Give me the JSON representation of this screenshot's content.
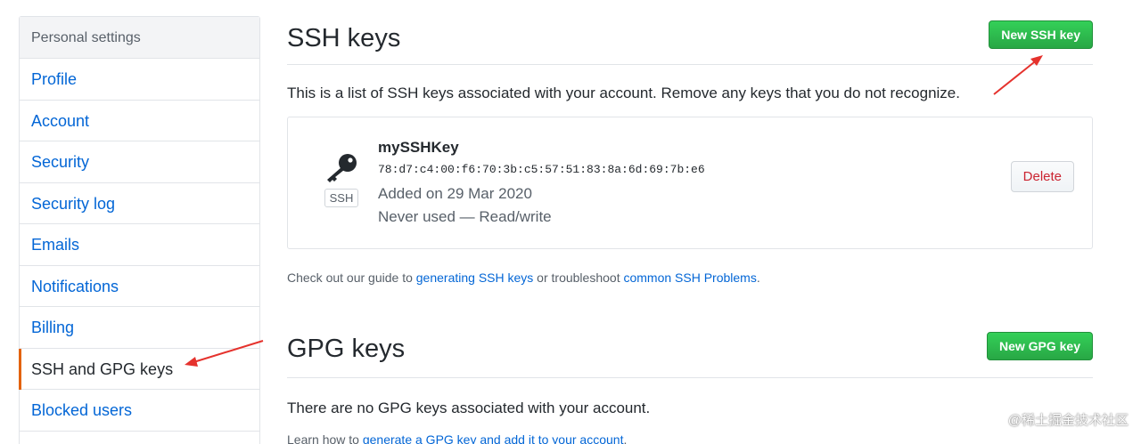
{
  "sidebar": {
    "header": "Personal settings",
    "items": [
      {
        "label": "Profile"
      },
      {
        "label": "Account"
      },
      {
        "label": "Security"
      },
      {
        "label": "Security log"
      },
      {
        "label": "Emails"
      },
      {
        "label": "Notifications"
      },
      {
        "label": "Billing"
      },
      {
        "label": "SSH and GPG keys",
        "selected": true
      },
      {
        "label": "Blocked users"
      }
    ]
  },
  "ssh": {
    "title": "SSH keys",
    "new_button": "New SSH key",
    "description": "This is a list of SSH keys associated with your account. Remove any keys that you do not recognize.",
    "key": {
      "name": "mySSHKey",
      "fingerprint": "78:d7:c4:00:f6:70:3b:c5:57:51:83:8a:6d:69:7b:e6",
      "added": "Added on 29 Mar 2020",
      "usage": "Never used — Read/write",
      "tag": "SSH",
      "icon": "key-icon",
      "delete_button": "Delete"
    },
    "guide": {
      "prefix": "Check out our guide to ",
      "link1": "generating SSH keys",
      "middle": " or troubleshoot ",
      "link2": "common SSH Problems",
      "suffix": "."
    }
  },
  "gpg": {
    "title": "GPG keys",
    "new_button": "New GPG key",
    "description": "There are no GPG keys associated with your account.",
    "learn": {
      "prefix": "Learn how to ",
      "link": "generate a GPG key and add it to your account",
      "suffix": "."
    }
  },
  "watermark": "@稀土掘金技术社区",
  "colors": {
    "accent_green": "#2ea44f",
    "link_blue": "#0366d6",
    "danger_red": "#cb2431",
    "selected_marker": "#e36209",
    "annotation_arrow": "#e5322d"
  }
}
